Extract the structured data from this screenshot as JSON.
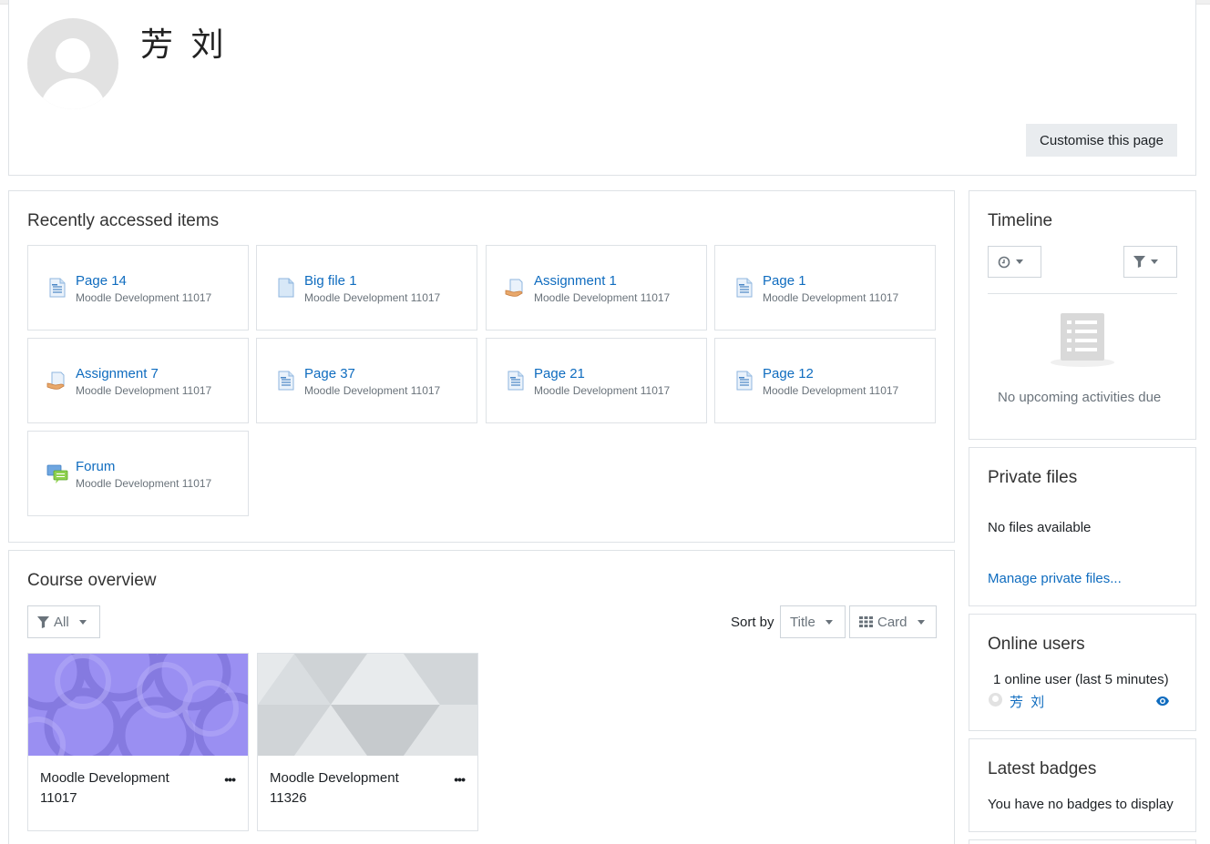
{
  "profile": {
    "name": "芳 刘",
    "customise_button": "Customise this page"
  },
  "recent": {
    "title": "Recently accessed items",
    "items": [
      {
        "name": "Page 14",
        "course": "Moodle Development 11017",
        "icon": "page-icon"
      },
      {
        "name": "Big file 1",
        "course": "Moodle Development 11017",
        "icon": "file-icon"
      },
      {
        "name": "Assignment 1",
        "course": "Moodle Development 11017",
        "icon": "assignment-icon"
      },
      {
        "name": "Page 1",
        "course": "Moodle Development 11017",
        "icon": "page-icon"
      },
      {
        "name": "Assignment 7",
        "course": "Moodle Development 11017",
        "icon": "assignment-icon"
      },
      {
        "name": "Page 37",
        "course": "Moodle Development 11017",
        "icon": "page-icon"
      },
      {
        "name": "Page 21",
        "course": "Moodle Development 11017",
        "icon": "page-icon"
      },
      {
        "name": "Page 12",
        "course": "Moodle Development 11017",
        "icon": "page-icon"
      },
      {
        "name": "Forum",
        "course": "Moodle Development 11017",
        "icon": "forum-icon"
      }
    ]
  },
  "overview": {
    "title": "Course overview",
    "filter_label": "All",
    "sort_label": "Sort by",
    "sort_value": "Title",
    "view_value": "Card",
    "courses": [
      {
        "name": "Moodle Development 11017",
        "pattern": "circles",
        "color": "#9a8ff2"
      },
      {
        "name": "Moodle Development 11326",
        "pattern": "hexagons",
        "color": "#d9dde0"
      }
    ]
  },
  "timeline": {
    "title": "Timeline",
    "empty": "No upcoming activities due"
  },
  "private_files": {
    "title": "Private files",
    "empty": "No files available",
    "manage_link": "Manage private files..."
  },
  "online_users": {
    "title": "Online users",
    "summary": "1 online user (last 5 minutes)",
    "users": [
      "芳 刘"
    ]
  },
  "badges": {
    "title": "Latest badges",
    "empty": "You have no badges to display"
  },
  "colors": {
    "link": "#0f6cbf",
    "muted": "#6a737b",
    "border": "#dee2e6"
  }
}
